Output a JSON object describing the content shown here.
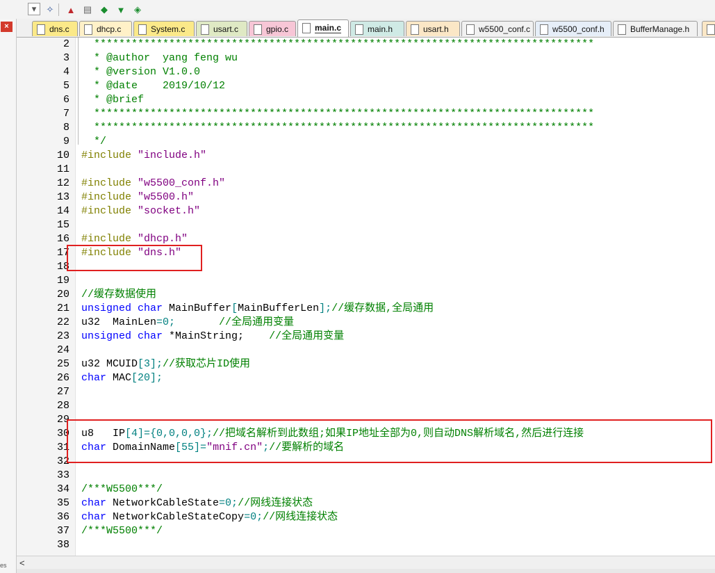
{
  "toolbar": {
    "buttons": [
      {
        "name": "dropdown-toggle",
        "glyph": "▾"
      },
      {
        "name": "wand-icon",
        "glyph": "✧"
      },
      {
        "name": "build-icon",
        "glyph": "▲"
      },
      {
        "name": "stack-icon",
        "glyph": "▤"
      },
      {
        "name": "diamond-icon",
        "glyph": "◆"
      },
      {
        "name": "download-icon",
        "glyph": "▼"
      },
      {
        "name": "load-icon",
        "glyph": "◈"
      }
    ]
  },
  "left_panel": {
    "close_glyph": "×",
    "strip_text": "es"
  },
  "tabs": [
    {
      "label": "dns.c",
      "color": "#fbe989",
      "active": false
    },
    {
      "label": "dhcp.c",
      "color": "#fff1c8",
      "active": false
    },
    {
      "label": "System.c",
      "color": "#fbe989",
      "active": false
    },
    {
      "label": "usart.c",
      "color": "#dfe9c4",
      "active": false
    },
    {
      "label": "gpio.c",
      "color": "#f7c6d6",
      "active": false
    },
    {
      "label": "main.c",
      "color": "#ffffff",
      "active": true
    },
    {
      "label": "main.h",
      "color": "#cfeae5",
      "active": false
    },
    {
      "label": "usart.h",
      "color": "#fbe7c6",
      "active": false
    },
    {
      "label": "w5500_conf.c",
      "color": "#f1f1f1",
      "active": false
    },
    {
      "label": "w5500_conf.h",
      "color": "#e6eef8",
      "active": false
    },
    {
      "label": "BufferManage.h",
      "color": "#f1f1f1",
      "active": false
    }
  ],
  "code_lines": [
    {
      "n": "2",
      "tokens": [
        {
          "t": "  ********************************************************************************",
          "c": "green"
        }
      ]
    },
    {
      "n": "3",
      "tokens": [
        {
          "t": "  * @author  yang feng wu",
          "c": "green"
        }
      ]
    },
    {
      "n": "4",
      "tokens": [
        {
          "t": "  * @version V1.0.0",
          "c": "green"
        }
      ]
    },
    {
      "n": "5",
      "tokens": [
        {
          "t": "  * @date    2019/10/12",
          "c": "green"
        }
      ]
    },
    {
      "n": "6",
      "tokens": [
        {
          "t": "  * @brief",
          "c": "green"
        }
      ]
    },
    {
      "n": "7",
      "tokens": [
        {
          "t": "  ********************************************************************************",
          "c": "green"
        }
      ]
    },
    {
      "n": "8",
      "tokens": [
        {
          "t": "  ********************************************************************************",
          "c": "green"
        }
      ]
    },
    {
      "n": "9",
      "tokens": [
        {
          "t": "  */",
          "c": "green"
        }
      ]
    },
    {
      "n": "10",
      "tokens": [
        {
          "t": "#include ",
          "c": "olive"
        },
        {
          "t": "\"include.h\"",
          "c": "str"
        }
      ]
    },
    {
      "n": "11",
      "tokens": []
    },
    {
      "n": "12",
      "tokens": [
        {
          "t": "#include ",
          "c": "olive"
        },
        {
          "t": "\"w5500_conf.h\"",
          "c": "str"
        }
      ]
    },
    {
      "n": "13",
      "tokens": [
        {
          "t": "#include ",
          "c": "olive"
        },
        {
          "t": "\"w5500.h\"",
          "c": "str"
        }
      ]
    },
    {
      "n": "14",
      "tokens": [
        {
          "t": "#include ",
          "c": "olive"
        },
        {
          "t": "\"socket.h\"",
          "c": "str"
        }
      ]
    },
    {
      "n": "15",
      "tokens": []
    },
    {
      "n": "16",
      "tokens": [
        {
          "t": "#include ",
          "c": "olive"
        },
        {
          "t": "\"dhcp.h\"",
          "c": "str"
        }
      ]
    },
    {
      "n": "17",
      "tokens": [
        {
          "t": "#include ",
          "c": "olive"
        },
        {
          "t": "\"dns.h\"",
          "c": "str"
        }
      ]
    },
    {
      "n": "18",
      "tokens": []
    },
    {
      "n": "19",
      "tokens": []
    },
    {
      "n": "20",
      "tokens": [
        {
          "t": "//缓存数据使用",
          "c": "green"
        }
      ]
    },
    {
      "n": "21",
      "tokens": [
        {
          "t": "unsigned char",
          "c": "blue"
        },
        {
          "t": " MainBuffer",
          "c": "black"
        },
        {
          "t": "[",
          "c": "teal"
        },
        {
          "t": "MainBufferLen",
          "c": "black"
        },
        {
          "t": "];",
          "c": "teal"
        },
        {
          "t": "//缓存数据,全局通用",
          "c": "green"
        }
      ]
    },
    {
      "n": "22",
      "tokens": [
        {
          "t": "u32  MainLen",
          "c": "black"
        },
        {
          "t": "=0;",
          "c": "teal"
        },
        {
          "t": "       //全局通用变量",
          "c": "green"
        }
      ]
    },
    {
      "n": "23",
      "tokens": [
        {
          "t": "unsigned char",
          "c": "blue"
        },
        {
          "t": " *MainString;",
          "c": "black"
        },
        {
          "t": "    //全局通用变量",
          "c": "green"
        }
      ]
    },
    {
      "n": "24",
      "tokens": []
    },
    {
      "n": "25",
      "tokens": [
        {
          "t": "u32 MCUID",
          "c": "black"
        },
        {
          "t": "[3];",
          "c": "teal"
        },
        {
          "t": "//获取芯片ID使用",
          "c": "green"
        }
      ]
    },
    {
      "n": "26",
      "tokens": [
        {
          "t": "char",
          "c": "blue"
        },
        {
          "t": " MAC",
          "c": "black"
        },
        {
          "t": "[20];",
          "c": "teal"
        }
      ]
    },
    {
      "n": "27",
      "tokens": []
    },
    {
      "n": "28",
      "tokens": []
    },
    {
      "n": "29",
      "tokens": []
    },
    {
      "n": "30",
      "tokens": [
        {
          "t": "u8   IP",
          "c": "black"
        },
        {
          "t": "[4]={0,0,0,0};",
          "c": "teal"
        },
        {
          "t": "//把域名解析到此数组;如果IP地址全部为0,则自动DNS解析域名,然后进行连接",
          "c": "green"
        }
      ]
    },
    {
      "n": "31",
      "tokens": [
        {
          "t": "char",
          "c": "blue"
        },
        {
          "t": " DomainName",
          "c": "black"
        },
        {
          "t": "[55]=",
          "c": "teal"
        },
        {
          "t": "\"mnif.cn\"",
          "c": "str"
        },
        {
          "t": ";",
          "c": "teal"
        },
        {
          "t": "//要解析的域名",
          "c": "green"
        }
      ]
    },
    {
      "n": "32",
      "tokens": []
    },
    {
      "n": "33",
      "tokens": []
    },
    {
      "n": "34",
      "tokens": [
        {
          "t": "/***W5500***/",
          "c": "green"
        }
      ]
    },
    {
      "n": "35",
      "tokens": [
        {
          "t": "char",
          "c": "blue"
        },
        {
          "t": " NetworkCableState",
          "c": "black"
        },
        {
          "t": "=0;",
          "c": "teal"
        },
        {
          "t": "//网线连接状态",
          "c": "green"
        }
      ]
    },
    {
      "n": "36",
      "tokens": [
        {
          "t": "char",
          "c": "blue"
        },
        {
          "t": " NetworkCableStateCopy",
          "c": "black"
        },
        {
          "t": "=0;",
          "c": "teal"
        },
        {
          "t": "//网线连接状态",
          "c": "green"
        }
      ]
    },
    {
      "n": "37",
      "tokens": [
        {
          "t": "/***W5500***/",
          "c": "green"
        }
      ]
    },
    {
      "n": "38",
      "tokens": []
    }
  ],
  "scrollbar": {
    "left_arrow": "<"
  }
}
